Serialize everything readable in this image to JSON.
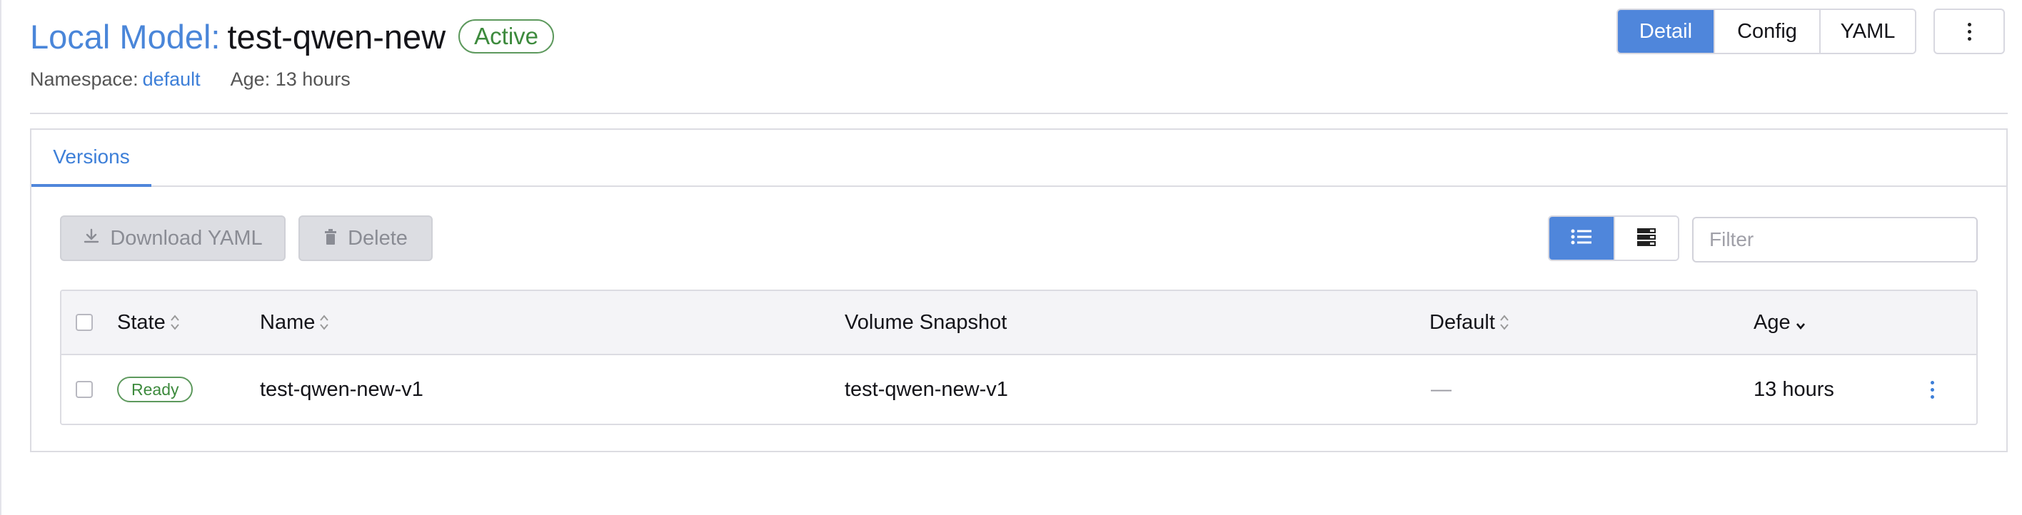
{
  "header": {
    "kind_label": "Local Model:",
    "name": "test-qwen-new",
    "status": "Active",
    "namespace_label": "Namespace:",
    "namespace_value": "default",
    "age_text": "Age: 13 hours"
  },
  "view_switch": {
    "detail": "Detail",
    "config": "Config",
    "yaml": "YAML",
    "active": "Detail"
  },
  "tabs": [
    {
      "label": "Versions",
      "active": true
    }
  ],
  "toolbar": {
    "download_label": "Download YAML",
    "delete_label": "Delete",
    "filter_placeholder": "Filter",
    "view_mode": "list"
  },
  "table": {
    "columns": [
      "State",
      "Name",
      "Volume Snapshot",
      "Default",
      "Age"
    ],
    "rows": [
      {
        "state": "Ready",
        "name": "test-qwen-new-v1",
        "volume_snapshot": "test-qwen-new-v1",
        "default": "—",
        "age": "13 hours"
      }
    ]
  },
  "colors": {
    "accent": "#4f86db",
    "success": "#3d8a3d"
  },
  "icons": [
    "more-vertical-icon",
    "download-icon",
    "trash-icon",
    "list-view-icon",
    "grid-view-icon",
    "sort-icon",
    "sort-desc-icon"
  ]
}
